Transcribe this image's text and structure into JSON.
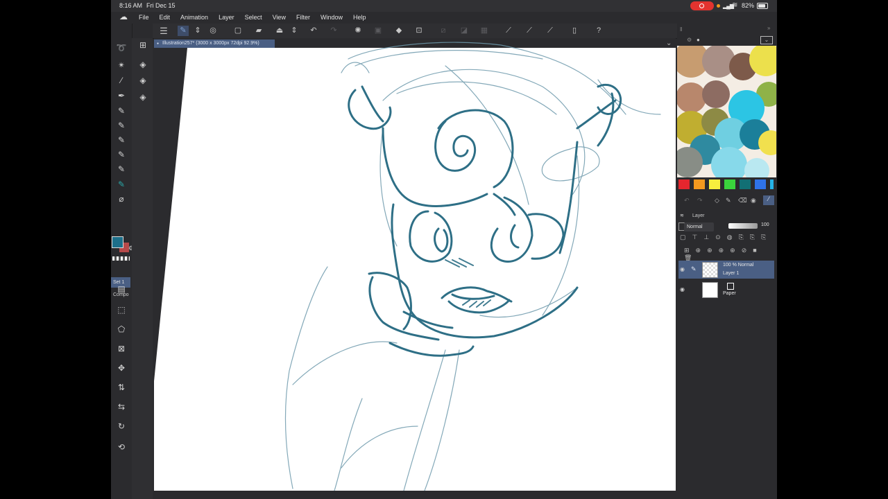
{
  "status": {
    "time": "8:16 AM",
    "date": "Fri Dec 15",
    "battery": "82%"
  },
  "menu": [
    "File",
    "Edit",
    "Animation",
    "Layer",
    "Select",
    "View",
    "Filter",
    "Window",
    "Help"
  ],
  "document": {
    "tab_title": "Illustration257* (3000 x 3000px 72dpi 92.9%)"
  },
  "left_panel": {
    "set_tab": "Set 1",
    "comp_tab": "Compo"
  },
  "colors": {
    "main": "#1d6f8a",
    "sub": "#b64a4a",
    "palette": [
      "#e5262e",
      "#f39a1f",
      "#f7ef3e",
      "#3ad43c",
      "#126f74",
      "#2f73e8",
      "#25b3e8"
    ]
  },
  "layers": {
    "panel_label": "Layer",
    "blend_mode": "Normal",
    "opacity": "100",
    "items": [
      {
        "name": "Layer 1",
        "info": "100 % Normal",
        "selected": true
      },
      {
        "name": "Paper",
        "info": "",
        "selected": false
      }
    ]
  }
}
